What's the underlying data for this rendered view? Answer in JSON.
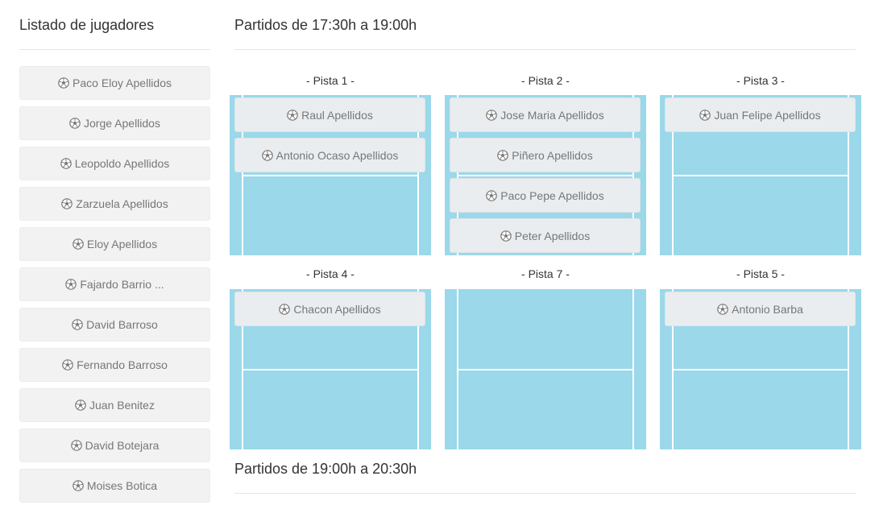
{
  "sidebar": {
    "title": "Listado de jugadores",
    "players": [
      {
        "name": "Paco Eloy Apellidos",
        "icon": "soccer-ball-icon"
      },
      {
        "name": "Jorge Apellidos",
        "icon": "soccer-ball-icon"
      },
      {
        "name": "Leopoldo Apellidos",
        "icon": "soccer-ball-icon"
      },
      {
        "name": "Zarzuela Apellidos",
        "icon": "soccer-ball-icon"
      },
      {
        "name": "Eloy Apellidos",
        "icon": "soccer-ball-icon"
      },
      {
        "name": "Fajardo Barrio ...",
        "icon": "soccer-ball-icon"
      },
      {
        "name": "David Barroso",
        "icon": "soccer-ball-icon"
      },
      {
        "name": "Fernando Barroso",
        "icon": "soccer-ball-icon"
      },
      {
        "name": "Juan Benitez",
        "icon": "soccer-ball-icon"
      },
      {
        "name": "David Botejara",
        "icon": "soccer-ball-icon"
      },
      {
        "name": "Moises Botica",
        "icon": "soccer-ball-icon"
      }
    ]
  },
  "sessions": [
    {
      "title": "Partidos de 17:30h a 19:00h",
      "courts": [
        {
          "label": "- Pista 1 -",
          "players": [
            "Raul Apellidos",
            "Antonio Ocaso Apellidos"
          ]
        },
        {
          "label": "- Pista 2 -",
          "players": [
            "Jose Maria Apellidos",
            "Piñero Apellidos",
            "Paco Pepe Apellidos",
            "Peter Apellidos"
          ]
        },
        {
          "label": "- Pista 3 -",
          "players": [
            "Juan Felipe Apellidos"
          ]
        },
        {
          "label": "- Pista 4 -",
          "players": [
            "Chacon Apellidos"
          ]
        },
        {
          "label": "- Pista 7 -",
          "players": []
        },
        {
          "label": "- Pista 5 -",
          "players": [
            "Antonio Barba"
          ]
        }
      ]
    },
    {
      "title": "Partidos de 19:00h a 20:30h",
      "courts": []
    }
  ],
  "colors": {
    "court": "#9ad8ea",
    "court_lines": "#ffffff",
    "chip": "#e9edf0",
    "player_item": "#f2f2f2",
    "text_muted": "#777777"
  }
}
